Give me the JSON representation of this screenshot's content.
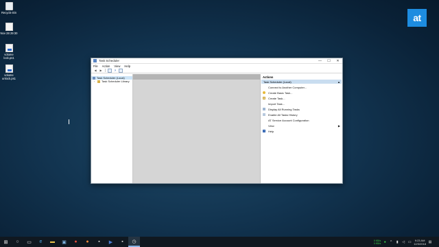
{
  "desktop": {
    "icons": [
      {
        "label": "Recycle Bin"
      },
      {
        "label": "Nov 28 29:30"
      },
      {
        "label": "volume lock.ps1"
      },
      {
        "label": "volume unlock.ps1"
      }
    ],
    "logo_text": "at"
  },
  "window": {
    "title": "Task Scheduler",
    "controls": {
      "minimize": "—",
      "maximize": "☐",
      "close": "✕"
    },
    "menu": [
      "File",
      "Action",
      "View",
      "Help"
    ],
    "tree": [
      {
        "label": "Task Scheduler (Local)",
        "selected": true
      },
      {
        "label": "Task Scheduler Library",
        "selected": false
      }
    ],
    "actions": {
      "header": "Actions",
      "group": "Task Scheduler (Local)",
      "items": [
        {
          "label": "Connect to Another Computer...",
          "icon": "none"
        },
        {
          "label": "Create Basic Task...",
          "icon": "wand-icon"
        },
        {
          "label": "Create Task...",
          "icon": "new-task-icon"
        },
        {
          "label": "Import Task...",
          "icon": "none"
        },
        {
          "label": "Display All Running Tasks",
          "icon": "list-icon"
        },
        {
          "label": "Enable All Tasks History",
          "icon": "history-icon"
        },
        {
          "label": "AT Service Account Configuration",
          "icon": "none"
        },
        {
          "label": "View",
          "icon": "none",
          "submenu": true
        },
        {
          "label": "Help",
          "icon": "help-icon"
        }
      ]
    }
  },
  "taskbar": {
    "network_up": "0 KB/s",
    "network_down": "0 KB/s",
    "time": "9:23 AM",
    "date": "12/3/2018"
  }
}
